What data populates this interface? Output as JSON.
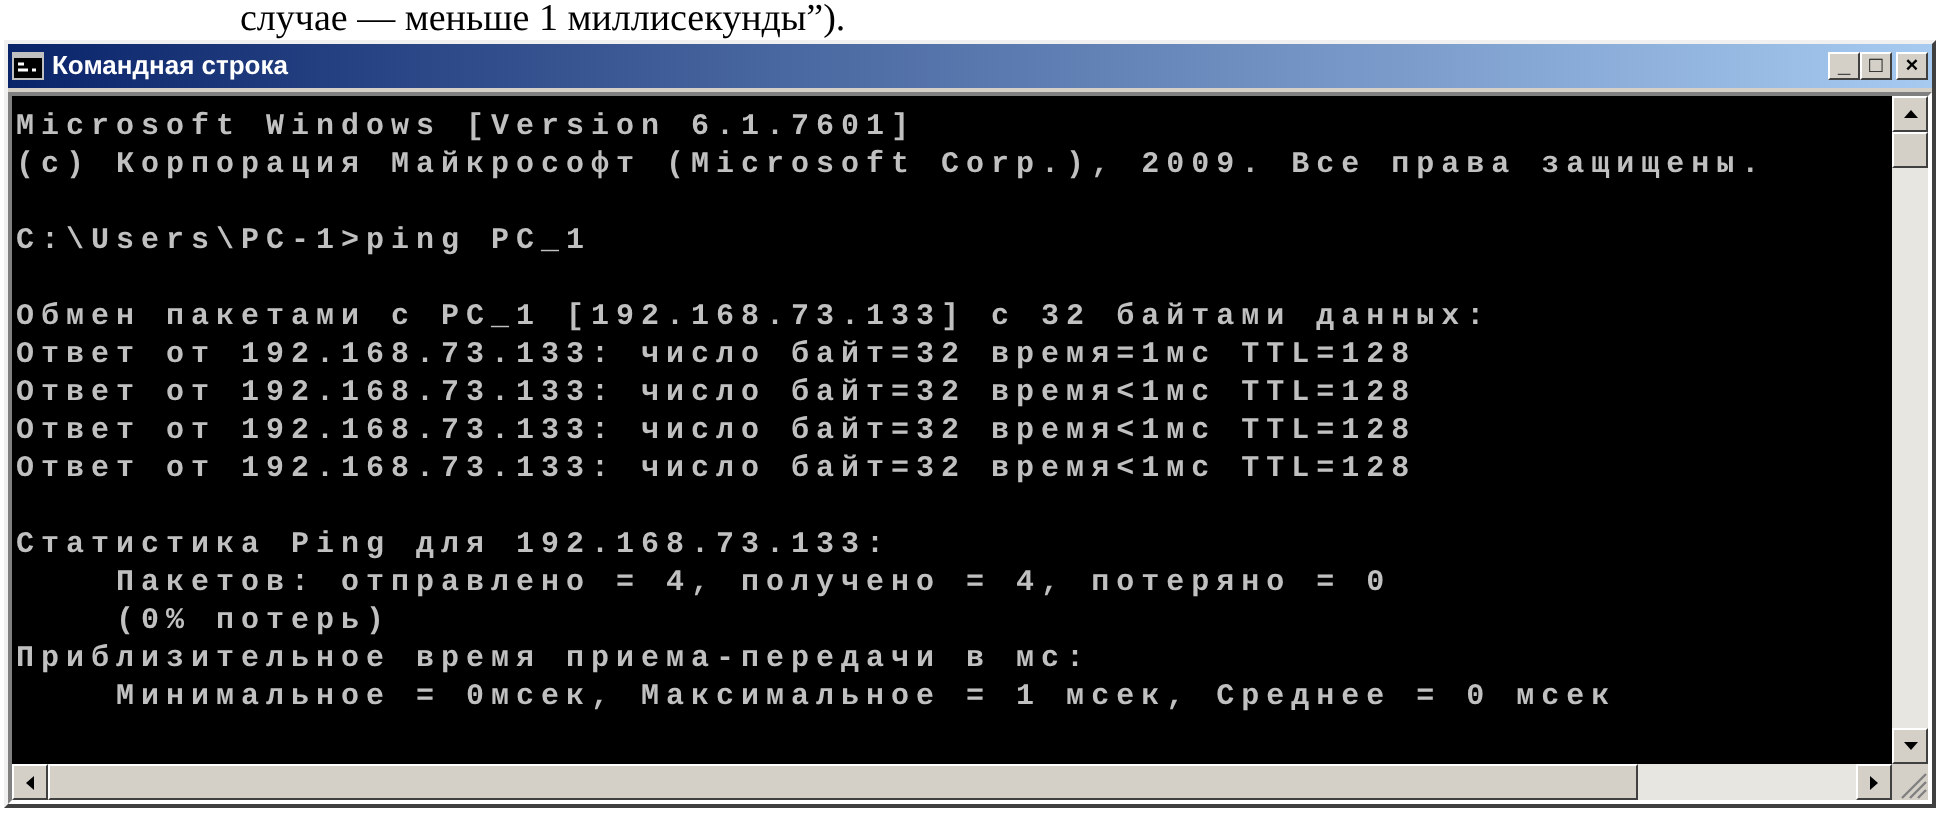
{
  "document_text": "случае — меньше 1 миллисекунды”).",
  "window": {
    "title": "Командная строка",
    "controls": [
      "_",
      "□",
      "×"
    ]
  },
  "console": {
    "blocks": [
      [
        "Microsoft Windows [Version 6.1.7601]",
        "(c) Корпорация Майкрософт (Microsoft Corp.), 2009. Все права защищены."
      ],
      [
        "C:\\Users\\PC-1>ping PC_1"
      ],
      [
        "Обмен пакетами с PC_1 [192.168.73.133] с 32 байтами данных:",
        "Ответ от 192.168.73.133: число байт=32 время=1мс TTL=128",
        "Ответ от 192.168.73.133: число байт=32 время<1мс TTL=128",
        "Ответ от 192.168.73.133: число байт=32 время<1мс TTL=128",
        "Ответ от 192.168.73.133: число байт=32 время<1мс TTL=128"
      ],
      [
        "Статистика Ping для 192.168.73.133:",
        "    Пакетов: отправлено = 4, получено = 4, потеряно = 0",
        "    (0% потерь)",
        "Приблизительное время приема-передачи в мс:",
        "    Минимальное = 0мсек, Максимальное = 1 мсек, Среднее = 0 мсек"
      ]
    ]
  }
}
